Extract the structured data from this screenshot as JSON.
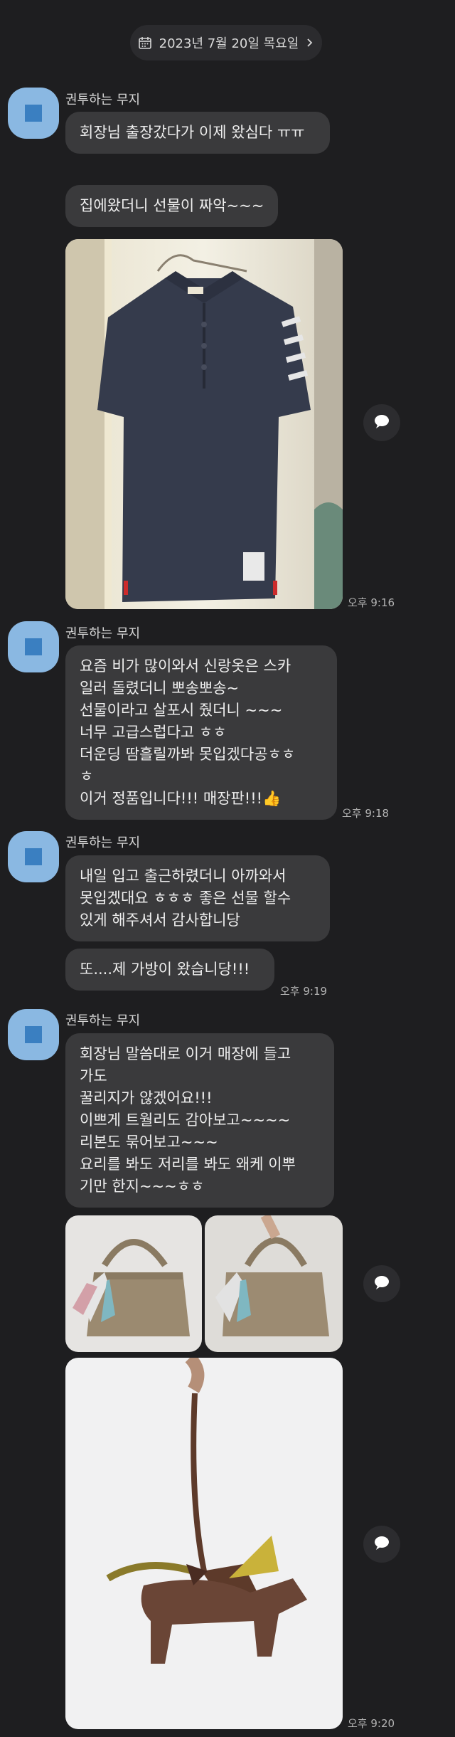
{
  "date_header": {
    "label": "2023년 7월 20일 목요일"
  },
  "groups": [
    {
      "sender": "권투하는 무지",
      "messages": [
        "회장님 출장갔다가 이제 왔심다 ㅠㅠ",
        "집에왔더니 선물이 짜악~~~"
      ],
      "time": "오후 9:16"
    },
    {
      "sender": "권투하는 무지",
      "messages": [
        "요즘 비가 많이와서 신랑옷은 스카\n일러 돌렸더니 뽀송뽀송~\n선물이라고 살포시 줬더니 ~~~\n너무 고급스럽다고 ㅎㅎ\n더운딩 땀흘릴까봐 못입겠다공ㅎㅎ\nㅎ\n이거 정품입니다!!! 매장판!!!👍"
      ],
      "time": "오후 9:18"
    },
    {
      "sender": "권투하는 무지",
      "messages": [
        "내일 입고 출근하렸더니 아까와서\n못입겠대요 ㅎㅎㅎ 좋은 선물 할수\n있게 해주셔서 감사합니당",
        "또....제 가방이 왔습니당!!!"
      ],
      "time": "오후 9:19"
    },
    {
      "sender": "권투하는 무지",
      "messages": [
        "회장님 말씀대로 이거 매장에 들고\n가도\n꿀리지가 않겠어요!!!\n이쁘게 트월리도 감아보고~~~~\n리본도 묶어보고~~~\n요리를 봐도 저리를 봐도 왜케 이뿌\n기만 한지~~~ㅎㅎ"
      ],
      "time": "오후 9:20"
    }
  ]
}
